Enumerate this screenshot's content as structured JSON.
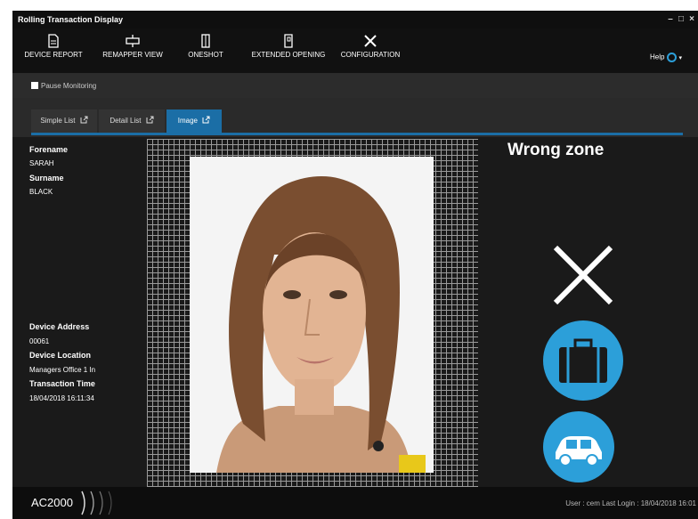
{
  "window": {
    "title": "Rolling Transaction Display",
    "minimize_glyph": "–",
    "maximize_glyph": "□",
    "close_glyph": "×"
  },
  "toolbar": {
    "device_report": "DEVICE REPORT",
    "remapper_view": "REMAPPER VIEW",
    "oneshot": "ONESHOT",
    "extended_opening": "EXTENDED OPENING",
    "configuration": "CONFIGURATION",
    "help": "Help"
  },
  "subbar": {
    "pause_label": "Pause Monitoring"
  },
  "tabs": [
    {
      "label": "Simple List"
    },
    {
      "label": "Detail List"
    },
    {
      "label": "Image"
    }
  ],
  "person": {
    "forename_label": "Forename",
    "forename": "SARAH",
    "surname_label": "Surname",
    "surname": "BLACK"
  },
  "device": {
    "address_label": "Device Address",
    "address": "00061",
    "location_label": "Device Location",
    "location": "Managers Office 1 In",
    "time_label": "Transaction Time",
    "time": "18/04/2018 16:11:34"
  },
  "result": {
    "message": "Wrong zone"
  },
  "footer": {
    "brand": "AC2000",
    "status": "User : cem   Last Login : 18/04/2018 16:01"
  },
  "colors": {
    "accent": "#1b6ea6",
    "icon_circle": "#2c9fd9",
    "background": "#1a1a1a"
  },
  "icons": [
    "document-icon",
    "remap-icon",
    "oneshot-icon",
    "extended-opening-icon",
    "configuration-icon",
    "external-link-icon",
    "cross-icon",
    "luggage-icon",
    "car-icon"
  ]
}
